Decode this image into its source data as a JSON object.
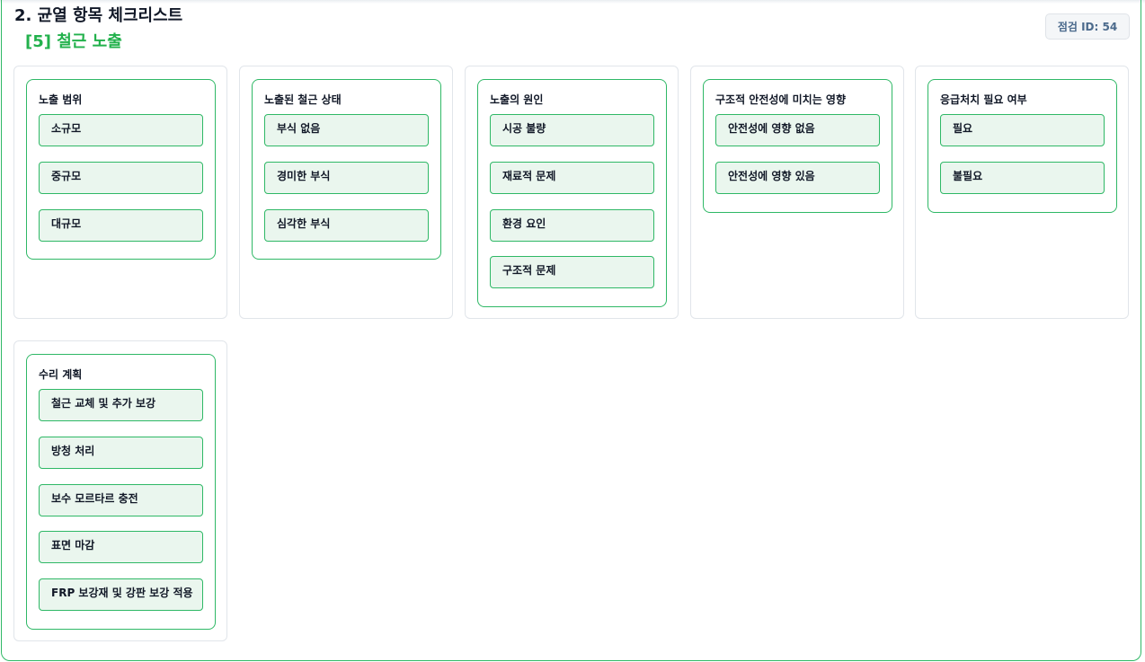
{
  "header": {
    "title": "2. 균열 항목 체크리스트",
    "subtitle": "[5] 철근 노출",
    "inspection_id": "점검 ID: 54"
  },
  "groups": [
    {
      "title": "노출 범위",
      "options": [
        "소규모",
        "중규모",
        "대규모"
      ]
    },
    {
      "title": "노출된 철근 상태",
      "options": [
        "부식 없음",
        "경미한 부식",
        "심각한 부식"
      ]
    },
    {
      "title": "노출의 원인",
      "options": [
        "시공 불량",
        "재료적 문제",
        "환경 요인",
        "구조적 문제"
      ]
    },
    {
      "title": "구조적 안전성에 미치는 영향",
      "options": [
        "안전성에 영향 없음",
        "안전성에 영향 있음"
      ]
    },
    {
      "title": "응급처치 필요 여부",
      "options": [
        "필요",
        "불필요"
      ]
    },
    {
      "title": "수리 계획",
      "options": [
        "철근 교체 및 추가 보강",
        "방청 처리",
        "보수 모르타르 충전",
        "표면 마감",
        "FRP 보강재 및 강판 보강 적용"
      ]
    }
  ],
  "colors": {
    "accent": "#22b14c",
    "border": "#2fb866",
    "option_bg": "#eaf6ee",
    "badge_text": "#4b6a8c"
  }
}
